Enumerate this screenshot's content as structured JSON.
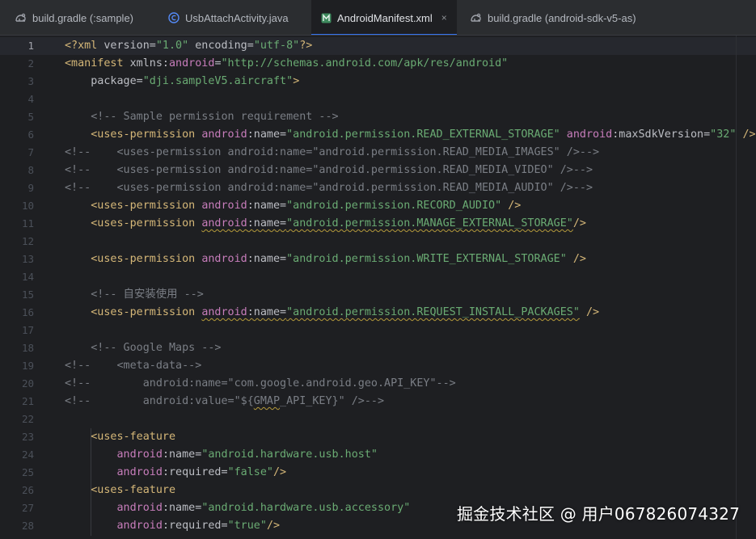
{
  "tabs": [
    {
      "label": "build.gradle (:sample)",
      "icon": "gradle-icon",
      "active": false
    },
    {
      "label": "UsbAttachActivity.java",
      "icon": "java-class-icon",
      "active": false
    },
    {
      "label": "AndroidManifest.xml",
      "icon": "manifest-icon",
      "active": true,
      "close": "×"
    },
    {
      "label": "build.gradle (android-sdk-v5-as)",
      "icon": "gradle-icon",
      "active": false
    }
  ],
  "colors": {
    "accent": "#3574f0",
    "tag": "#d5b778",
    "namespace": "#c77dbb",
    "value": "#6aab73",
    "comment": "#7a7e85",
    "text": "#bcbec4"
  },
  "editor": {
    "current_line": 1,
    "lines": [
      {
        "n": "1",
        "t": [
          [
            "tag",
            "<?xml "
          ],
          [
            "attr",
            "version="
          ],
          [
            "val",
            "\"1.0\""
          ],
          [
            "attr",
            " encoding="
          ],
          [
            "val",
            "\"utf-8\""
          ],
          [
            "tag",
            "?>"
          ]
        ]
      },
      {
        "n": "2",
        "t": [
          [
            "tag",
            "<manifest "
          ],
          [
            "attr",
            "xmlns:"
          ],
          [
            "ns",
            "android"
          ],
          [
            "attr",
            "="
          ],
          [
            "val",
            "\"http://schemas.android.com/apk/res/android\""
          ]
        ]
      },
      {
        "n": "3",
        "t": [
          [
            "pl",
            "    "
          ],
          [
            "attr",
            "package="
          ],
          [
            "val",
            "\"dji.sampleV5.aircraft\""
          ],
          [
            "tag",
            ">"
          ]
        ]
      },
      {
        "n": "4",
        "t": []
      },
      {
        "n": "5",
        "t": [
          [
            "pl",
            "    "
          ],
          [
            "cm",
            "<!-- Sample permission requirement -->"
          ]
        ]
      },
      {
        "n": "6",
        "t": [
          [
            "pl",
            "    "
          ],
          [
            "tag",
            "<uses-permission "
          ],
          [
            "ns",
            "android"
          ],
          [
            "attr",
            ":name="
          ],
          [
            "val",
            "\"android.permission.READ_EXTERNAL_STORAGE\""
          ],
          [
            "attr",
            " "
          ],
          [
            "ns",
            "android"
          ],
          [
            "attr",
            ":maxSdkVersion="
          ],
          [
            "val",
            "\"32\""
          ],
          [
            "tag",
            " />"
          ]
        ]
      },
      {
        "n": "7",
        "t": [
          [
            "cm",
            "<!--    <uses-permission android:name=\"android.permission.READ_MEDIA_IMAGES\" />-->"
          ]
        ]
      },
      {
        "n": "8",
        "t": [
          [
            "cm",
            "<!--    <uses-permission android:name=\"android.permission.READ_MEDIA_VIDEO\" />-->"
          ]
        ]
      },
      {
        "n": "9",
        "t": [
          [
            "cm",
            "<!--    <uses-permission android:name=\"android.permission.READ_MEDIA_AUDIO\" />-->"
          ]
        ]
      },
      {
        "n": "10",
        "t": [
          [
            "pl",
            "    "
          ],
          [
            "tag",
            "<uses-permission "
          ],
          [
            "ns",
            "android"
          ],
          [
            "attr",
            ":name="
          ],
          [
            "val",
            "\"android.permission.RECORD_AUDIO\""
          ],
          [
            "tag",
            " />"
          ]
        ]
      },
      {
        "n": "11",
        "t": [
          [
            "pl",
            "    "
          ],
          [
            "tag",
            "<uses-permission "
          ],
          [
            "ns",
            "android",
            "w"
          ],
          [
            "attr",
            ":name=",
            "w"
          ],
          [
            "val",
            "\"android.permission.MANAGE_EXTERNAL_STORAGE\"",
            "w"
          ],
          [
            "tag",
            "/>"
          ]
        ]
      },
      {
        "n": "12",
        "t": []
      },
      {
        "n": "13",
        "t": [
          [
            "pl",
            "    "
          ],
          [
            "tag",
            "<uses-permission "
          ],
          [
            "ns",
            "android"
          ],
          [
            "attr",
            ":name="
          ],
          [
            "val",
            "\"android.permission.WRITE_EXTERNAL_STORAGE\""
          ],
          [
            "tag",
            " />"
          ]
        ]
      },
      {
        "n": "14",
        "t": []
      },
      {
        "n": "15",
        "t": [
          [
            "pl",
            "    "
          ],
          [
            "cm",
            "<!-- 自安装使用 -->"
          ]
        ]
      },
      {
        "n": "16",
        "t": [
          [
            "pl",
            "    "
          ],
          [
            "tag",
            "<uses-permission "
          ],
          [
            "ns",
            "android",
            "w"
          ],
          [
            "attr",
            ":name=",
            "w"
          ],
          [
            "val",
            "\"android.permission.REQUEST_INSTALL_PACKAGES\"",
            "w"
          ],
          [
            "tag",
            " />"
          ]
        ]
      },
      {
        "n": "17",
        "t": []
      },
      {
        "n": "18",
        "t": [
          [
            "pl",
            "    "
          ],
          [
            "cm",
            "<!-- Google Maps -->"
          ]
        ]
      },
      {
        "n": "19",
        "t": [
          [
            "cm",
            "<!--    <meta-data-->"
          ]
        ]
      },
      {
        "n": "20",
        "t": [
          [
            "cm",
            "<!--        android:name=\"com.google.android.geo.API_KEY\"-->"
          ]
        ]
      },
      {
        "n": "21",
        "t": [
          [
            "cm",
            "<!--        android:value=\"${"
          ],
          [
            "cm",
            "GMAP",
            "w"
          ],
          [
            "cm",
            "_API_KEY}\" />-->"
          ]
        ]
      },
      {
        "n": "22",
        "t": []
      },
      {
        "n": "23",
        "t": [
          [
            "pl",
            "    "
          ],
          [
            "tag",
            "<uses-feature"
          ]
        ]
      },
      {
        "n": "24",
        "t": [
          [
            "pl",
            "        "
          ],
          [
            "ns",
            "android"
          ],
          [
            "attr",
            ":name="
          ],
          [
            "val",
            "\"android.hardware.usb.host\""
          ]
        ]
      },
      {
        "n": "25",
        "t": [
          [
            "pl",
            "        "
          ],
          [
            "ns",
            "android"
          ],
          [
            "attr",
            ":required="
          ],
          [
            "val",
            "\"false\""
          ],
          [
            "tag",
            "/>"
          ]
        ]
      },
      {
        "n": "26",
        "t": [
          [
            "pl",
            "    "
          ],
          [
            "tag",
            "<uses-feature"
          ]
        ]
      },
      {
        "n": "27",
        "t": [
          [
            "pl",
            "        "
          ],
          [
            "ns",
            "android"
          ],
          [
            "attr",
            ":name="
          ],
          [
            "val",
            "\"android.hardware.usb.accessory\""
          ]
        ]
      },
      {
        "n": "28",
        "t": [
          [
            "pl",
            "        "
          ],
          [
            "ns",
            "android"
          ],
          [
            "attr",
            ":required="
          ],
          [
            "val",
            "\"true\""
          ],
          [
            "tag",
            "/>"
          ]
        ]
      }
    ]
  },
  "watermark": "掘金技术社区 @ 用户067826074327"
}
